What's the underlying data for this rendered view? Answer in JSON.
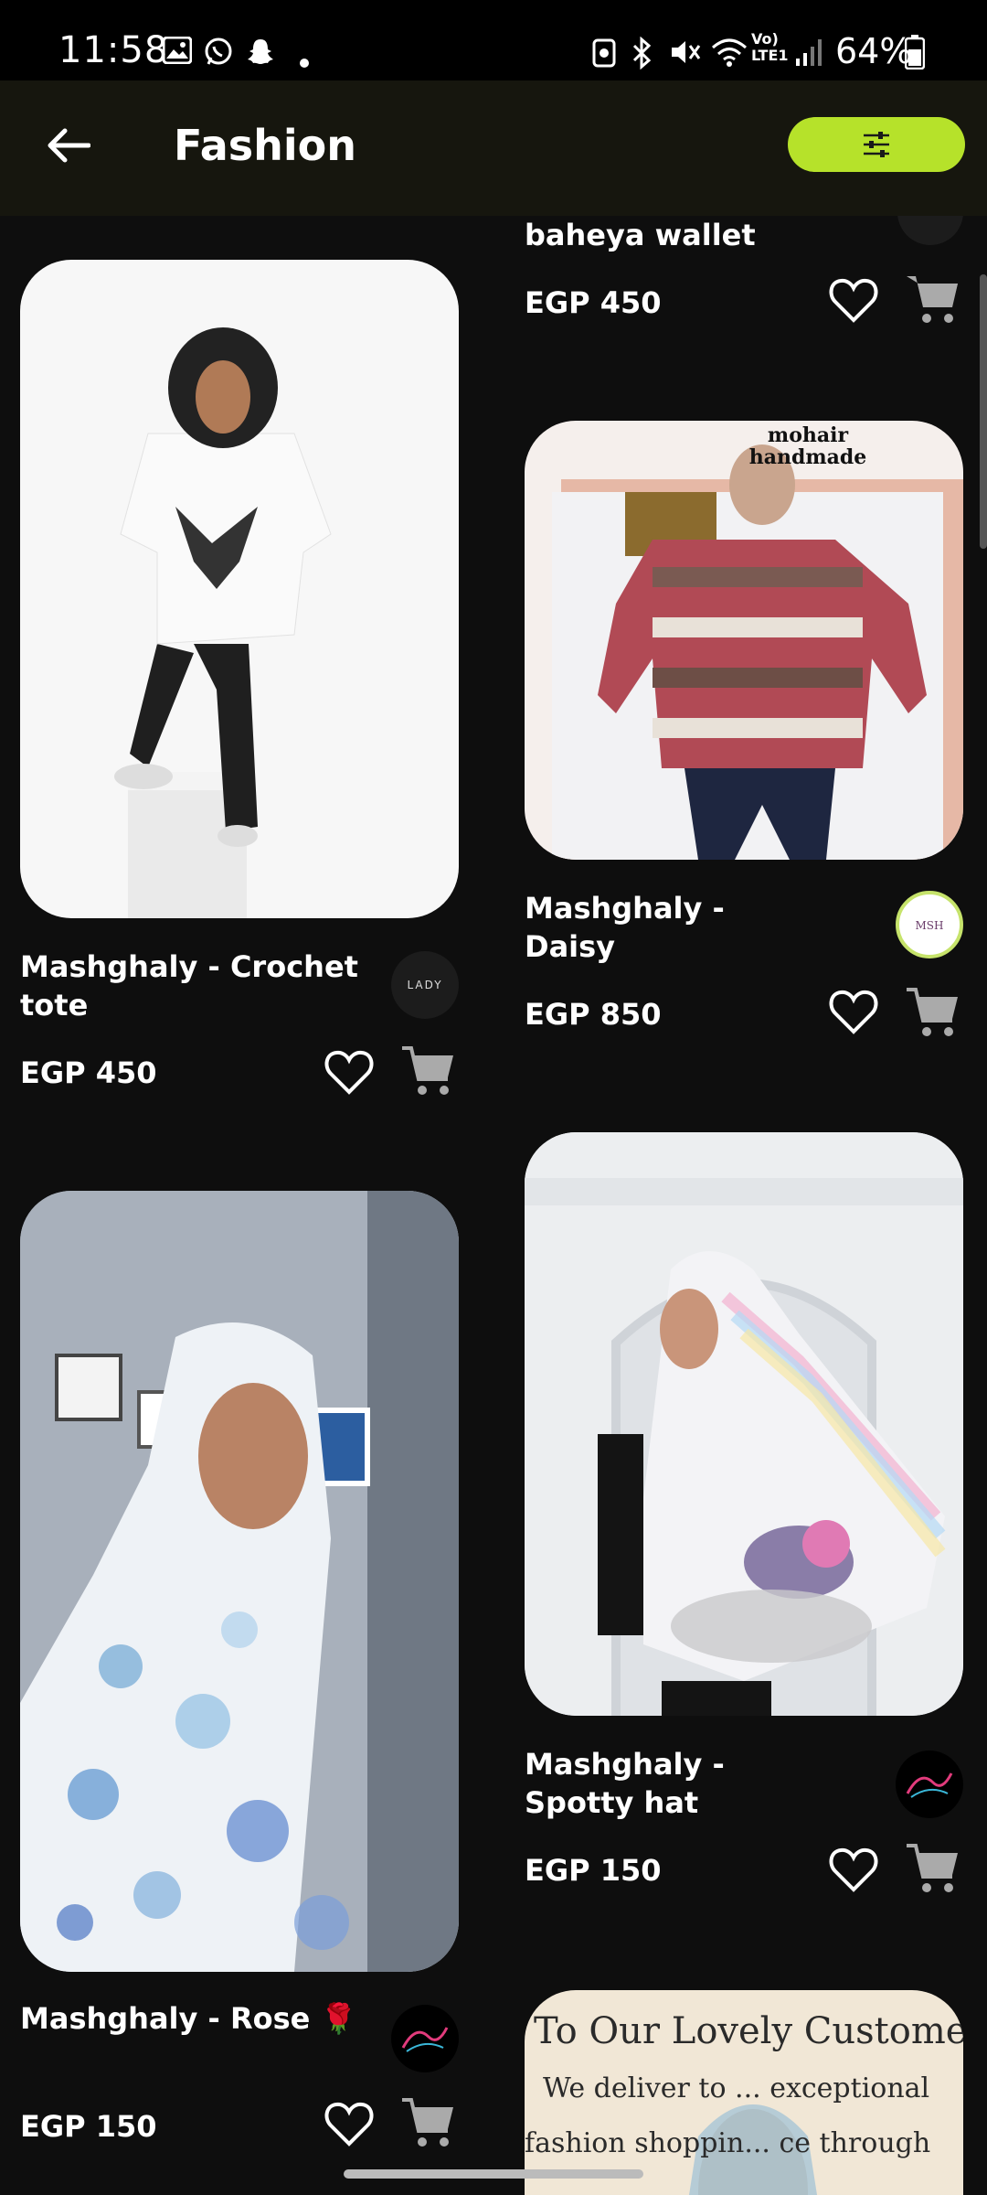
{
  "status": {
    "time": "11:58",
    "battery": "64%"
  },
  "header": {
    "title": "Fashion"
  },
  "products": [
    {
      "name": "baheya wallet",
      "price": "EGP 450"
    },
    {
      "name": "Mashghaly - Crochet tote",
      "price": "EGP 450",
      "logo": "LADY"
    },
    {
      "name": "Mashghaly - Daisy",
      "price": "EGP 850",
      "image_text": "mohair handmade"
    },
    {
      "name": "Mashghaly - Spotty hat",
      "price": "EGP 150"
    },
    {
      "name": "Mashghaly - Rose 🌹",
      "price": "EGP 150"
    },
    {
      "image_text": "To Our Lovely Customers",
      "image_text2": "We deliver to ... exceptional",
      "image_text3": "fashion shoppin... ce through"
    }
  ]
}
